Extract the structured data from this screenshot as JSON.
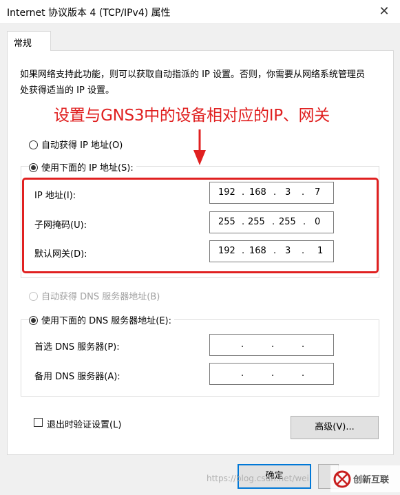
{
  "window": {
    "title": "Internet 协议版本 4 (TCP/IPv4) 属性",
    "close_glyph": "✕"
  },
  "tabs": [
    {
      "label": "常规"
    }
  ],
  "description": "如果网络支持此功能，则可以获取自动指派的 IP 设置。否则，你需要从网络系统管理员处获得适当的 IP 设置。",
  "annotation": "设置与GNS3中的设备相对应的IP、网关",
  "ip_section": {
    "auto_label": "自动获得 IP 地址(O)",
    "manual_label": "使用下面的 IP 地址(S):",
    "selected": "manual",
    "fields": [
      {
        "label": "IP 地址(I):",
        "octets": [
          "192",
          "168",
          "3",
          "7"
        ]
      },
      {
        "label": "子网掩码(U):",
        "octets": [
          "255",
          "255",
          "255",
          "0"
        ]
      },
      {
        "label": "默认网关(D):",
        "octets": [
          "192",
          "168",
          "3",
          "1"
        ]
      }
    ]
  },
  "dns_section": {
    "auto_label": "自动获得 DNS 服务器地址(B)",
    "manual_label": "使用下面的 DNS 服务器地址(E):",
    "selected": "manual",
    "fields": [
      {
        "label": "首选 DNS 服务器(P):",
        "octets": [
          "",
          "",
          "",
          ""
        ]
      },
      {
        "label": "备用 DNS 服务器(A):",
        "octets": [
          "",
          "",
          "",
          ""
        ]
      }
    ]
  },
  "validate_on_exit": {
    "label": "退出时验证设置(L)",
    "checked": false
  },
  "buttons": {
    "advanced": "高级(V)...",
    "ok": "确定"
  },
  "watermark": "https://blog.csdn.net/wei",
  "logo_text": "创新互联",
  "colors": {
    "annotation_red": "#e02020",
    "ok_border": "#0078d7"
  }
}
